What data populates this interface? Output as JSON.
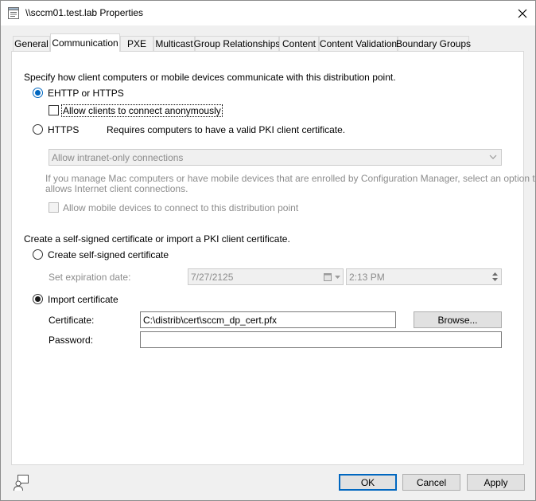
{
  "window": {
    "title": "\\\\sccm01.test.lab Properties"
  },
  "tabs": [
    {
      "label": "General"
    },
    {
      "label": "Communication"
    },
    {
      "label": "PXE"
    },
    {
      "label": "Multicast"
    },
    {
      "label": "Group Relationships"
    },
    {
      "label": "Content"
    },
    {
      "label": "Content Validation"
    },
    {
      "label": "Boundary Groups"
    }
  ],
  "communication": {
    "heading": "Specify how client computers or mobile devices communicate with this distribution point.",
    "ehttp_label": "EHTTP or HTTPS",
    "anon_label": "Allow clients to connect anonymously",
    "https_label": "HTTPS",
    "https_desc": "Requires computers to have a valid PKI client certificate.",
    "intranet_select": "Allow intranet-only connections",
    "mac_note_line1": "If you manage Mac computers or have mobile devices that are enrolled by Configuration Manager, select an option that",
    "mac_note_line2": "allows Internet client connections.",
    "mobile_label": "Allow mobile devices to connect to this distribution point"
  },
  "certificate": {
    "heading": "Create a self-signed certificate or import a PKI client certificate.",
    "self_signed_label": "Create self-signed certificate",
    "expiration_label": "Set expiration date:",
    "expiration_date": "7/27/2125",
    "expiration_time": "2:13 PM",
    "import_label": "Import certificate",
    "cert_label": "Certificate:",
    "cert_value": "C:\\distrib\\cert\\sccm_dp_cert.pfx",
    "browse_label": "Browse...",
    "password_label": "Password:",
    "password_value": ""
  },
  "footer": {
    "ok_label": "OK",
    "cancel_label": "Cancel",
    "apply_label": "Apply"
  }
}
